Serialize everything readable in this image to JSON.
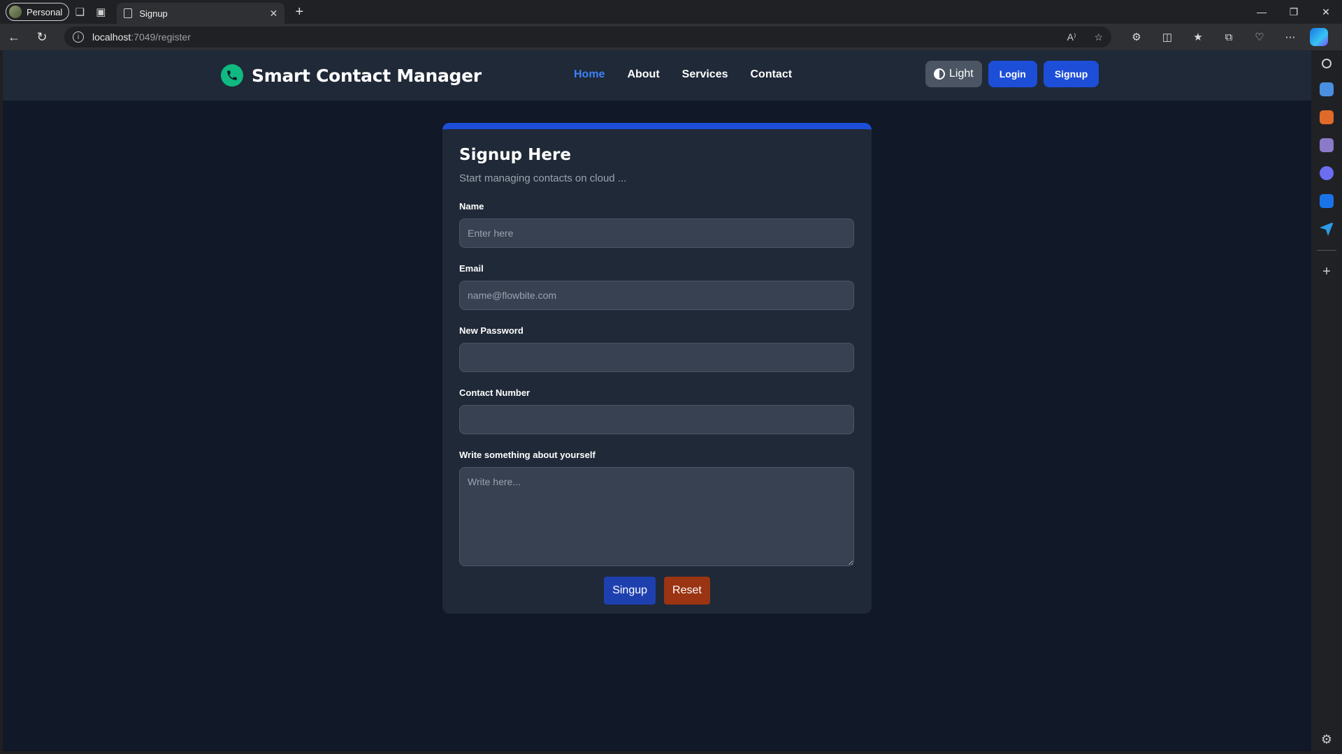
{
  "browser": {
    "profile_label": "Personal",
    "tab_title": "Signup",
    "url_host": "localhost",
    "url_rest": ":7049/register"
  },
  "site": {
    "brand": "Smart Contact Manager",
    "menu": [
      "Home",
      "About",
      "Services",
      "Contact"
    ],
    "active_menu": "Home",
    "theme_label": "Light",
    "login_label": "Login",
    "signup_label": "Signup",
    "accent_color": "#1d4ed8",
    "brand_icon_color": "#10b981"
  },
  "form": {
    "title": "Signup Here",
    "subtitle": "Start managing contacts on cloud ...",
    "name_label": "Name",
    "name_placeholder": "Enter here",
    "email_label": "Email",
    "email_placeholder": "name@flowbite.com",
    "password_label": "New Password",
    "phone_label": "Contact Number",
    "about_label": "Write something about yourself",
    "about_placeholder": "Write here...",
    "submit_label": "Singup",
    "reset_label": "Reset"
  }
}
